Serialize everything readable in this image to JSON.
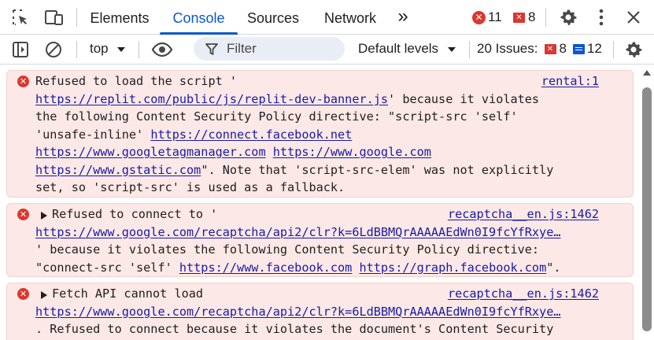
{
  "tabbar": {
    "icons": [
      "inspect-element-icon",
      "device-toolbar-icon"
    ],
    "tabs": [
      {
        "label": "Elements",
        "active": false
      },
      {
        "label": "Console",
        "active": true
      },
      {
        "label": "Sources",
        "active": false
      },
      {
        "label": "Network",
        "active": false
      }
    ],
    "more_tabs_glyph": "»",
    "error_count": "11",
    "warning_flag_count": "8",
    "settings_icon": "gear-icon",
    "menu_icon": "kebab-menu-icon",
    "close_icon": "close-icon"
  },
  "toolbar": {
    "context": "top",
    "filter_placeholder": "Filter",
    "levels": "Default levels",
    "issues_label": "20 Issues:",
    "issues_errors": "8",
    "issues_info": "12"
  },
  "colors": {
    "accent": "#0b57d0",
    "error": "#dc362e",
    "error_bg": "#fce8e6",
    "link": "#1a1aa6"
  },
  "messages": [
    {
      "source": "rental:1",
      "expandable": false,
      "lines": [
        [
          {
            "t": "Refused to load the script '"
          }
        ],
        [
          {
            "t": "https://replit.com/public/js/replit-dev-banner.js",
            "link": true
          },
          {
            "t": "' because it violates"
          }
        ],
        [
          {
            "t": "the following Content Security Policy directive: \"script-src 'self'"
          }
        ],
        [
          {
            "t": "'unsafe-inline' "
          },
          {
            "t": "https://connect.facebook.net",
            "link": true
          }
        ],
        [
          {
            "t": "https://www.googletagmanager.com",
            "link": true
          },
          {
            "t": " "
          },
          {
            "t": "https://www.google.com",
            "link": true
          }
        ],
        [
          {
            "t": "https://www.gstatic.com",
            "link": true
          },
          {
            "t": "\". Note that 'script-src-elem' was not explicitly"
          }
        ],
        [
          {
            "t": "set, so 'script-src' is used as a fallback."
          }
        ]
      ]
    },
    {
      "source": "recaptcha__en.js:1462",
      "expandable": true,
      "lines": [
        [
          {
            "t": "Refused to connect to '"
          }
        ],
        [
          {
            "t": "https://www.google.com/recaptcha/api2/clr?k=6LdBBMQrAAAAAEdWn0I9fcYfRxye…",
            "link": true
          }
        ],
        [
          {
            "t": "' because it violates the following Content Security Policy directive:"
          }
        ],
        [
          {
            "t": "\"connect-src 'self' "
          },
          {
            "t": "https://www.facebook.com",
            "link": true
          },
          {
            "t": " "
          },
          {
            "t": "https://graph.facebook.com",
            "link": true
          },
          {
            "t": "\"."
          }
        ]
      ]
    },
    {
      "source": "recaptcha__en.js:1462",
      "expandable": true,
      "lines": [
        [
          {
            "t": "Fetch API cannot load"
          }
        ],
        [
          {
            "t": "https://www.google.com/recaptcha/api2/clr?k=6LdBBMQrAAAAAEdWn0I9fcYfRxye…",
            "link": true
          }
        ],
        [
          {
            "t": ". Refused to connect because it violates the document's Content Security"
          }
        ]
      ]
    }
  ]
}
